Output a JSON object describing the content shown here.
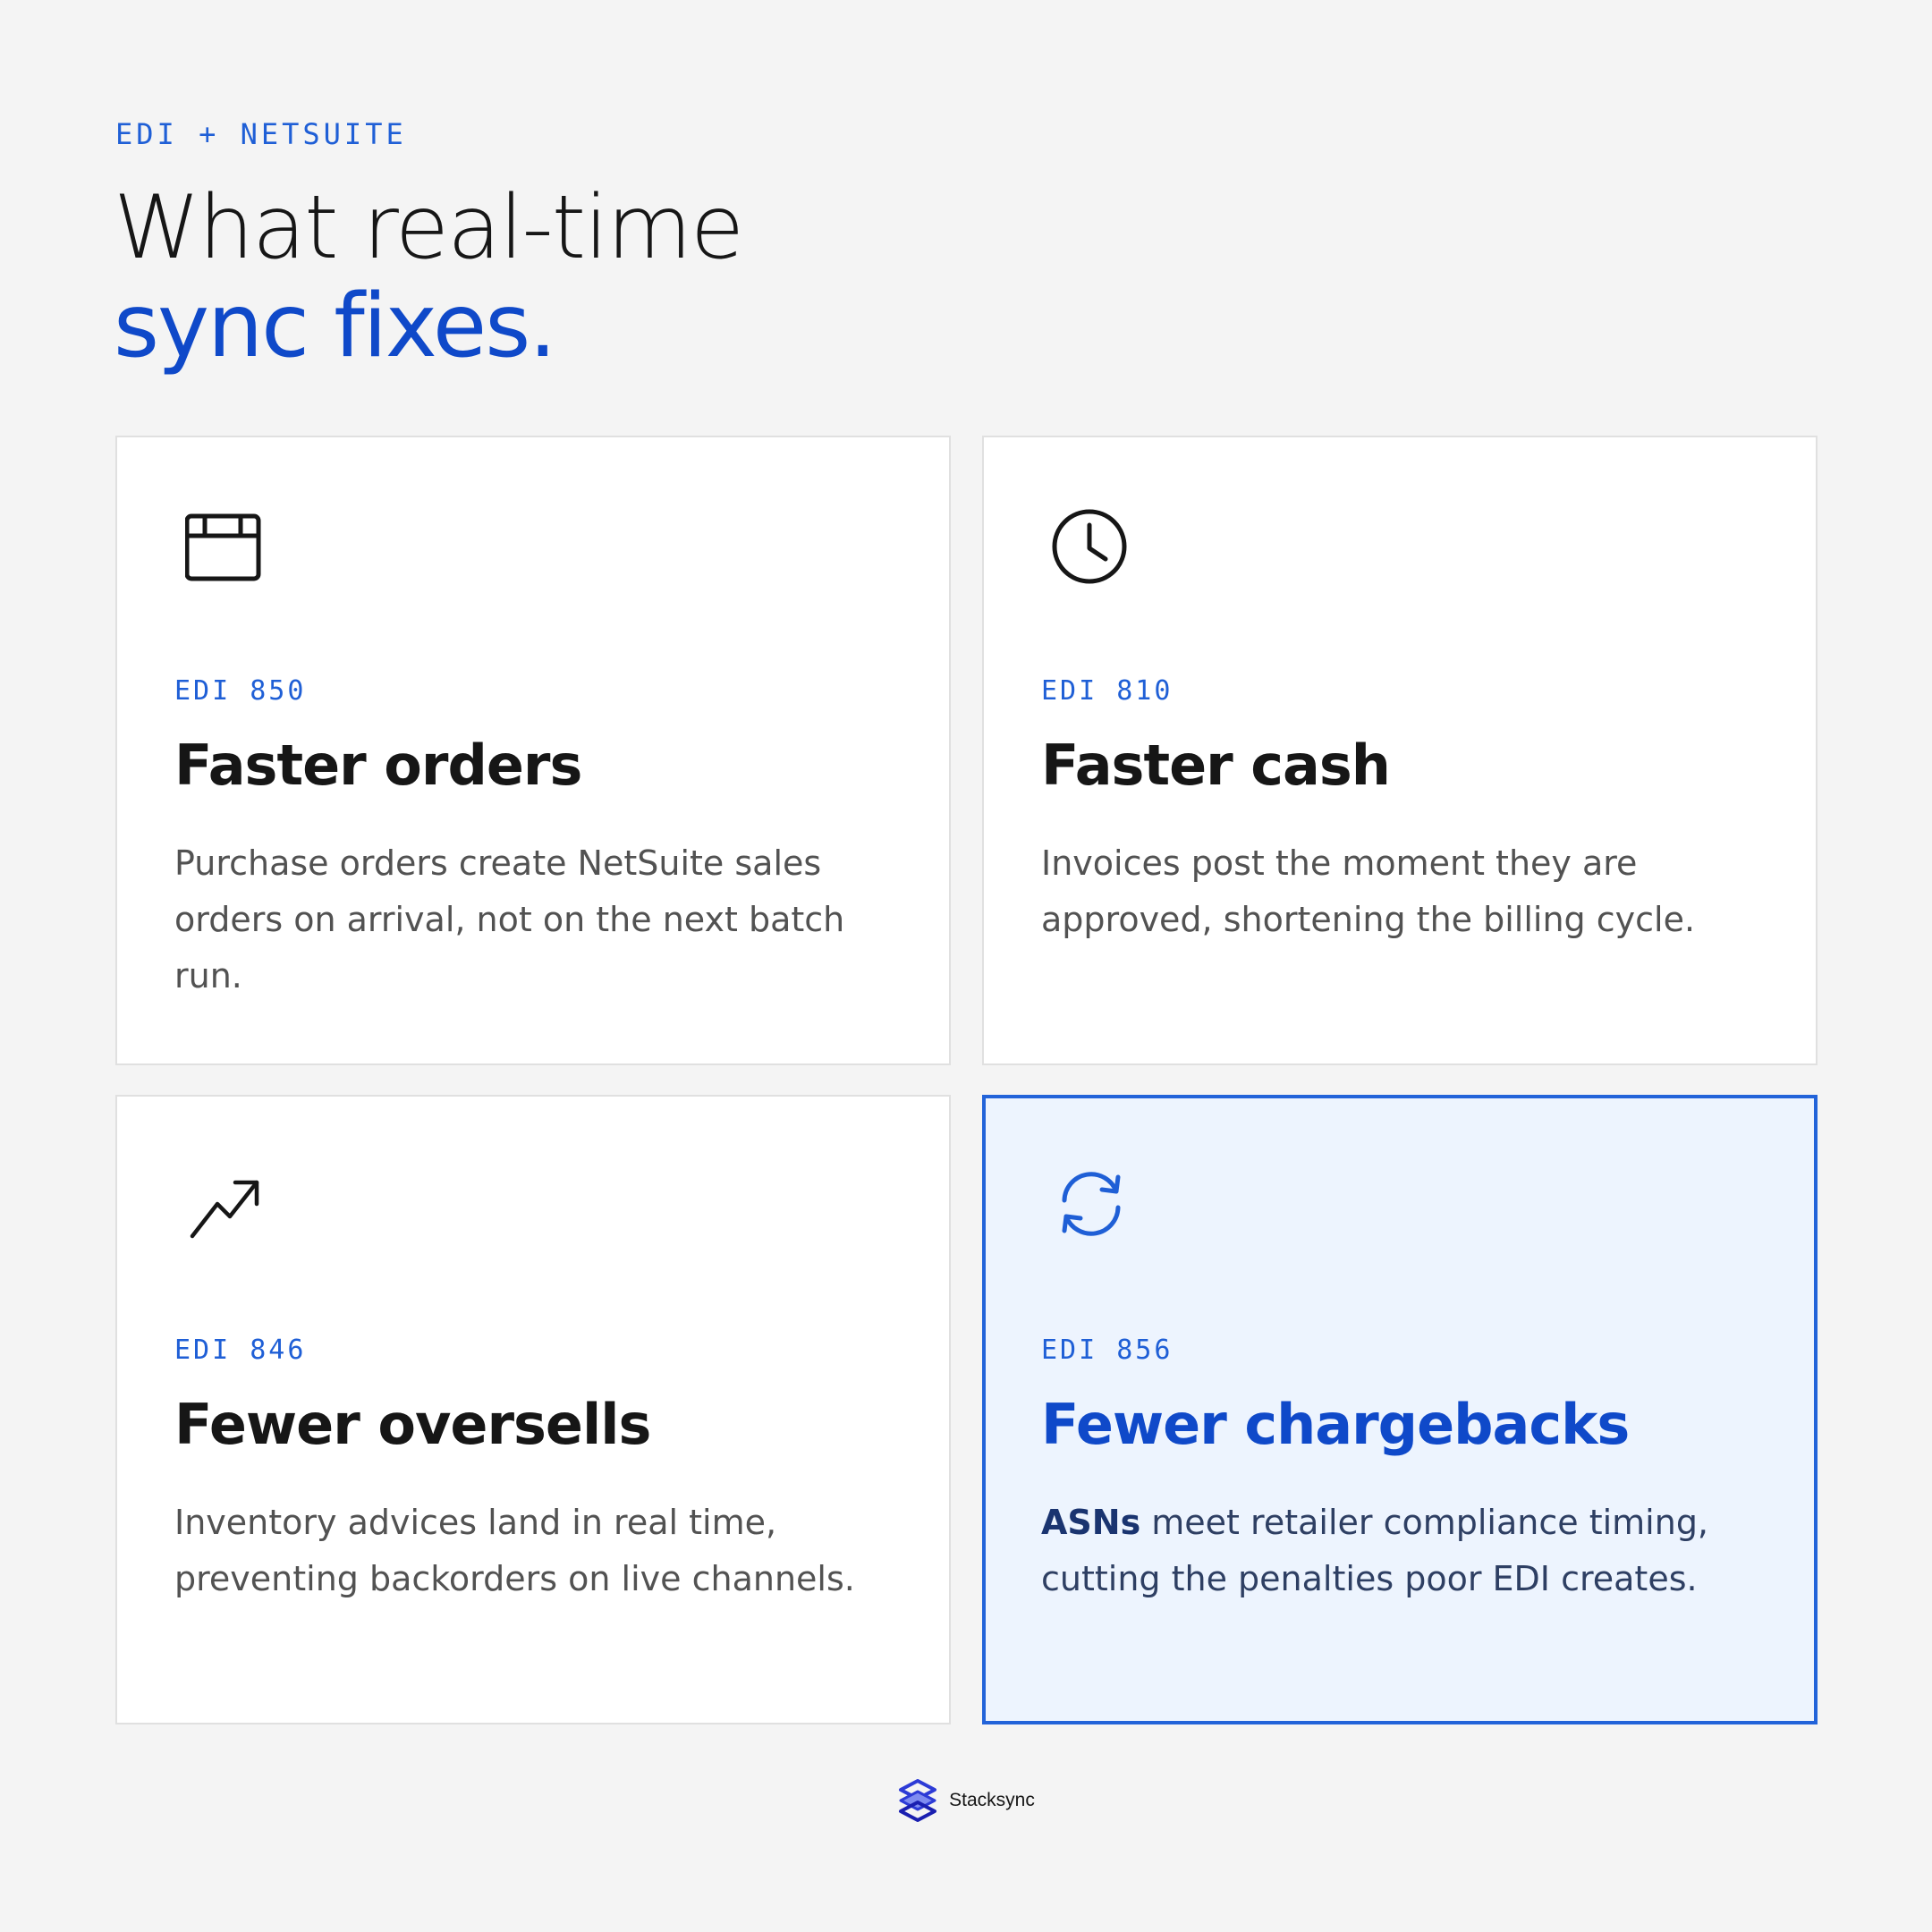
{
  "header": {
    "eyebrow": "EDI + NETSUITE",
    "title_line1": "What real-time",
    "title_line2": "sync fixes."
  },
  "cards": [
    {
      "icon": "window-icon",
      "code": "EDI 850",
      "title": "Faster orders",
      "body": "Purchase orders create NetSuite sales orders on arrival, not on the next batch run."
    },
    {
      "icon": "clock-icon",
      "code": "EDI 810",
      "title": "Faster cash",
      "body": "Invoices post the moment they are approved, shortening the billing cycle."
    },
    {
      "icon": "trend-up-icon",
      "code": "EDI 846",
      "title": "Fewer oversells",
      "body": "Inventory advices land in real time, preventing backorders on live channels."
    },
    {
      "icon": "sync-icon",
      "code": "EDI 856",
      "title": "Fewer chargebacks",
      "body_strong": "ASNs",
      "body": " meet retailer compliance timing, cutting the penalties poor EDI creates."
    }
  ],
  "footer": {
    "logo_icon": "stacksync-logo-icon",
    "brand": "Stacksync"
  },
  "colors": {
    "accent": "#0f49c9",
    "accent_light": "#1f5fd6",
    "highlight_bg": "#edf4fe",
    "highlight_border": "#2263d9",
    "page_bg": "#f4f4f4"
  }
}
